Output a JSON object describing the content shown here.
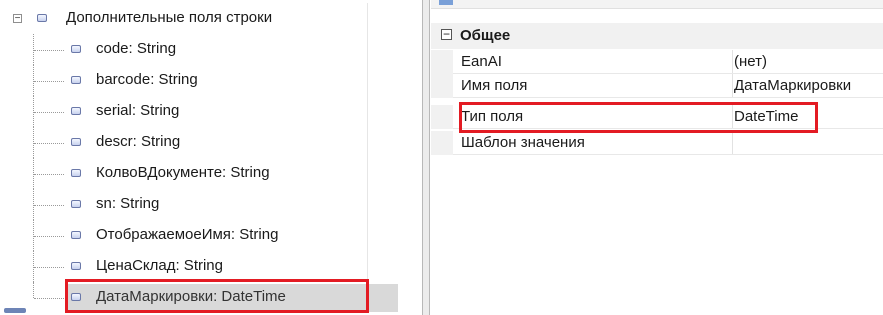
{
  "tree": {
    "root_label": "Дополнительные поля строки",
    "root_expander": "−",
    "items": [
      {
        "label": "code: String"
      },
      {
        "label": "barcode: String"
      },
      {
        "label": "serial: String"
      },
      {
        "label": "descr: String"
      },
      {
        "label": "КолвоВДокументе: String"
      },
      {
        "label": "sn: String"
      },
      {
        "label": "ОтображаемоеИмя: String"
      },
      {
        "label": "ЦенаСклад: String"
      },
      {
        "label": "ДатаМаркировки: DateTime",
        "selected": true
      }
    ]
  },
  "properties": {
    "category": {
      "collapse_glyph": "⊟",
      "label": "Общее"
    },
    "rows": [
      {
        "name": "EanAI",
        "value": "(нет)"
      },
      {
        "name": "Имя поля",
        "value": "ДатаМаркировки"
      },
      {
        "name": "Тип поля",
        "value": "DateTime"
      },
      {
        "name": "Шаблон значения",
        "value": ""
      }
    ]
  },
  "colors": {
    "highlight": "#e31b23",
    "selection": "#d9d9d9",
    "category_bg": "#f1f1f1"
  }
}
